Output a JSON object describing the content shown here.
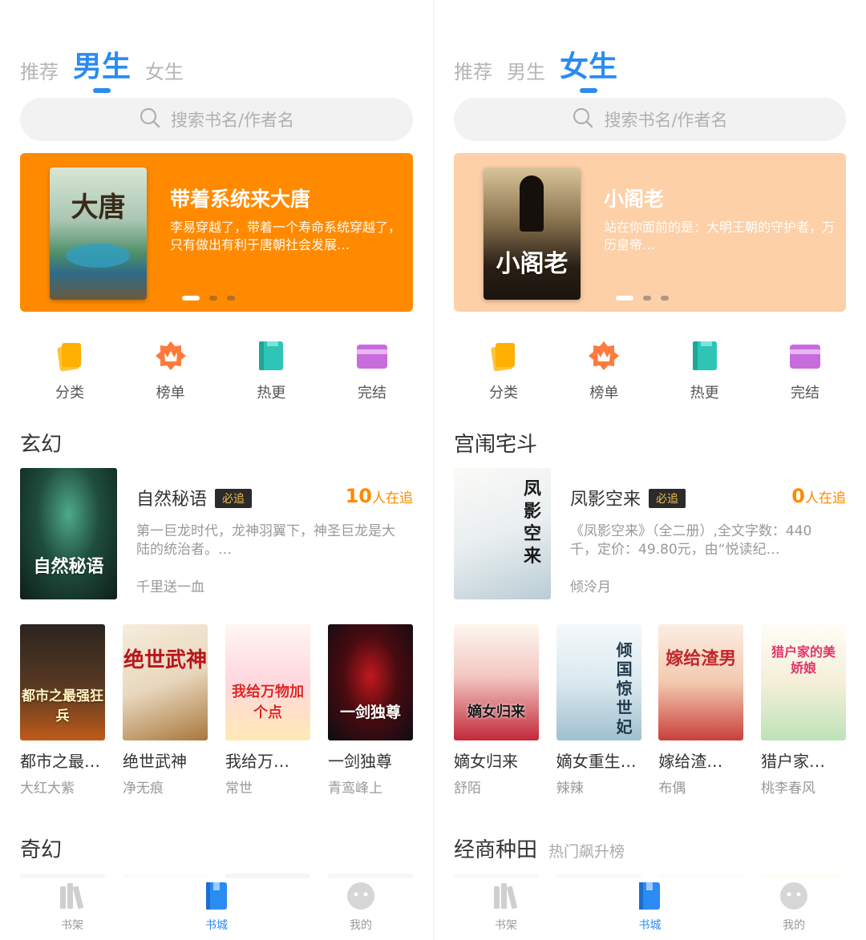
{
  "colors": {
    "accent": "#2a8bf2",
    "muted": "#b5b5b5",
    "count": "#ff8a00",
    "badge_bg": "#2b2b2b",
    "badge_text": "#f3c24a"
  },
  "screens": [
    {
      "tabs": [
        {
          "label": "推荐",
          "active": false
        },
        {
          "label": "男生",
          "active": true
        },
        {
          "label": "女生",
          "active": false
        }
      ],
      "search": {
        "placeholder": "搜索书名/作者名",
        "icon": "search-icon"
      },
      "banner": {
        "bg": "#ff8a00",
        "cover_text": "大唐",
        "title": "带着系统来大唐",
        "desc": "李易穿越了，带着一个寿命系统穿越了，只有做出有利于唐朝社会发展…",
        "slide": 1,
        "slides": 3
      },
      "categories": [
        {
          "label": "分类",
          "icon": "category-icon"
        },
        {
          "label": "榜单",
          "icon": "ranking-icon"
        },
        {
          "label": "热更",
          "icon": "hot-update-icon"
        },
        {
          "label": "完结",
          "icon": "completed-icon"
        }
      ],
      "section1": {
        "title": "玄幻",
        "feature": {
          "cover_text": "自然秘语",
          "name": "自然秘语",
          "badge": "必追",
          "count_num": "10",
          "count_label": "人在追",
          "desc": "第一巨龙时代，龙神羽翼下，神圣巨龙是大陆的统治者。…",
          "author": "千里送一血"
        },
        "books": [
          {
            "name": "都市之最…",
            "author": "大红大紫",
            "cover_text": "都市之最强狂兵"
          },
          {
            "name": "绝世武神",
            "author": "净无痕",
            "cover_text": "绝世武神"
          },
          {
            "name": "我给万…",
            "author": "常世",
            "cover_text": "我给万物加个点"
          },
          {
            "name": "一剑独尊",
            "author": "青鸾峰上",
            "cover_text": "一剑独尊"
          }
        ]
      },
      "section2": {
        "title": "奇幻",
        "subtitle": ""
      },
      "tabbar": [
        {
          "label": "书架",
          "icon": "bookshelf-icon",
          "active": false
        },
        {
          "label": "书城",
          "icon": "bookstore-icon",
          "active": true
        },
        {
          "label": "我的",
          "icon": "profile-icon",
          "active": false
        }
      ]
    },
    {
      "tabs": [
        {
          "label": "推荐",
          "active": false
        },
        {
          "label": "男生",
          "active": false
        },
        {
          "label": "女生",
          "active": true
        }
      ],
      "search": {
        "placeholder": "搜索书名/作者名",
        "icon": "search-icon"
      },
      "banner": {
        "bg": "#fdd0a8",
        "cover_text": "小阁老",
        "title": "小阁老",
        "desc": "站在你面前的是：大明王朝的守护者，万历皇帝…",
        "slide": 1,
        "slides": 3
      },
      "categories": [
        {
          "label": "分类",
          "icon": "category-icon"
        },
        {
          "label": "榜单",
          "icon": "ranking-icon"
        },
        {
          "label": "热更",
          "icon": "hot-update-icon"
        },
        {
          "label": "完结",
          "icon": "completed-icon"
        }
      ],
      "section1": {
        "title": "宫闱宅斗",
        "feature": {
          "cover_text": "凤影空来",
          "name": "凤影空来",
          "badge": "必追",
          "count_num": "0",
          "count_label": "人在追",
          "desc": "《凤影空来》（全二册）,全文字数：440千，定价：49.80元，由“悦读纪…",
          "author": "倾泠月"
        },
        "books": [
          {
            "name": "嫡女归来",
            "author": "舒陌",
            "cover_text": "嫡女归来"
          },
          {
            "name": "嫡女重生…",
            "author": "辣辣",
            "cover_text": "倾国惊世妃"
          },
          {
            "name": "嫁给渣…",
            "author": "布偶",
            "cover_text": "嫁给渣男"
          },
          {
            "name": "猎户家…",
            "author": "桃李春风",
            "cover_text": "猎户家的美娇娘"
          }
        ]
      },
      "section2": {
        "title": "经商种田",
        "subtitle": "热门飙升榜"
      },
      "tabbar": [
        {
          "label": "书架",
          "icon": "bookshelf-icon",
          "active": false
        },
        {
          "label": "书城",
          "icon": "bookstore-icon",
          "active": true
        },
        {
          "label": "我的",
          "icon": "profile-icon",
          "active": false
        }
      ]
    }
  ]
}
